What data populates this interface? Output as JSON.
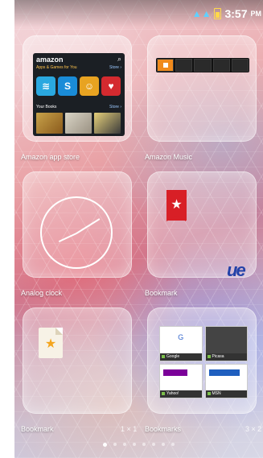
{
  "status_bar": {
    "time": "3:57",
    "suffix": "PM"
  },
  "widgets": [
    {
      "label": "Amazon app store",
      "size": ""
    },
    {
      "label": "Amazon Music",
      "size": ""
    },
    {
      "label": "Analog clock",
      "size": ""
    },
    {
      "label": "Bookmark",
      "size": ""
    },
    {
      "label": "Bookmark",
      "size": "1 × 1"
    },
    {
      "label": "Bookmarks",
      "size": "3 × 2"
    }
  ],
  "amazon_preview": {
    "logo": "amazon",
    "section_apps": "Apps & Games for You",
    "section_books": "Your Books",
    "more": "Store ›"
  },
  "bookmark_thumbs": [
    "Google",
    "Picasa",
    "Yahoo!",
    "MSN"
  ],
  "colors": {
    "accent_red": "#d81f26",
    "amazon_orange": "#f08a1c",
    "star_gold": "#f4a51e"
  },
  "pager": {
    "count": 8,
    "active": 0
  }
}
